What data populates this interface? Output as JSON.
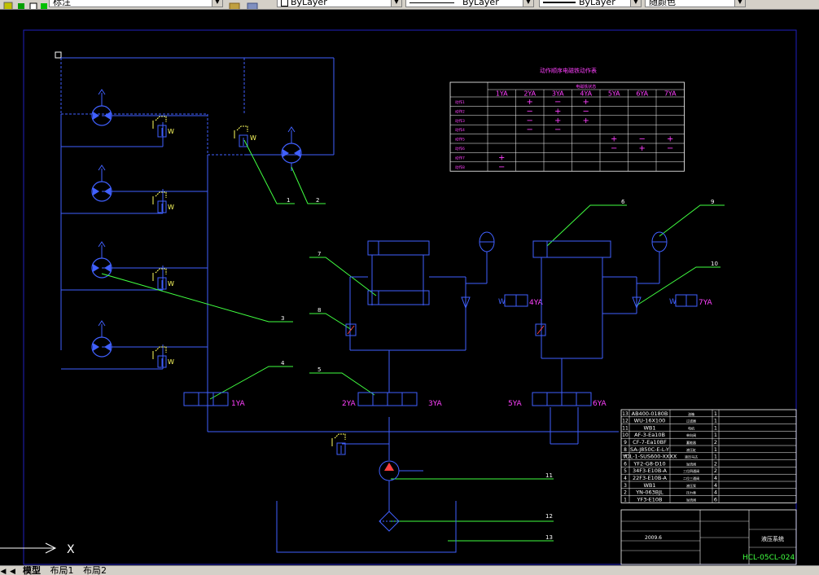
{
  "toolbar": {
    "textstyle": {
      "value": "标注"
    },
    "layer_color": {
      "value": "ByLayer"
    },
    "linetype": {
      "value": "ByLayer"
    },
    "lineweight": {
      "value": "ByLayer"
    },
    "plotstyle": {
      "value": "随颜色"
    }
  },
  "tabs": {
    "model": "模型",
    "layout1": "布局1",
    "layout2": "布局2"
  },
  "drawing": {
    "table_title": "动作顺序电磁铁动作表",
    "table_header": "电磁铁状态",
    "yas": [
      "1YA",
      "2YA",
      "3YA",
      "4YA",
      "5YA",
      "6YA",
      "7YA"
    ],
    "table_rows": [
      {
        "name": "动作1",
        "cells": [
          "",
          "+",
          "−",
          "+",
          "",
          "",
          ""
        ]
      },
      {
        "name": "动作2",
        "cells": [
          "",
          "−",
          "+",
          "−",
          "",
          "",
          ""
        ]
      },
      {
        "name": "动作3",
        "cells": [
          "",
          "−",
          "+",
          "+",
          "",
          "",
          ""
        ]
      },
      {
        "name": "动作4",
        "cells": [
          "",
          "−",
          "−",
          "",
          "",
          "",
          ""
        ]
      },
      {
        "name": "动作5",
        "cells": [
          "",
          "",
          "",
          "",
          "+",
          "−",
          "+"
        ]
      },
      {
        "name": "动作6",
        "cells": [
          "",
          "",
          "",
          "",
          "−",
          "+",
          "−"
        ]
      },
      {
        "name": "动作7",
        "cells": [
          "+",
          "",
          "",
          "",
          "",
          "",
          ""
        ]
      },
      {
        "name": "动作8",
        "cells": [
          "−",
          "",
          "",
          "",
          "",
          "",
          ""
        ]
      }
    ],
    "valve_labels": {
      "v1": "1YA",
      "v2": "2YA",
      "v3": "3YA",
      "v4": "4YA",
      "v5": "5YA",
      "v6": "6YA",
      "v7": "7YA"
    },
    "spring_mark": "W",
    "callouts": [
      "1",
      "2",
      "3",
      "4",
      "5",
      "6",
      "7",
      "8",
      "9",
      "10",
      "11",
      "12",
      "13"
    ],
    "parts": [
      {
        "no": "13",
        "code": "AB400-0180B",
        "name": "油箱",
        "qty": "1"
      },
      {
        "no": "12",
        "code": "WU-16X100",
        "name": "过滤器",
        "qty": "1"
      },
      {
        "no": "11",
        "code": "WB1",
        "name": "电机",
        "qty": "1"
      },
      {
        "no": "10",
        "code": "AF-3-Ea10B",
        "name": "单向阀",
        "qty": "1"
      },
      {
        "no": "9",
        "code": "CF-7-Ea10BF",
        "name": "蓄能器",
        "qty": "2"
      },
      {
        "no": "8",
        "code": "SA-J850C-E-L-Y",
        "name": "液压缸",
        "qty": "1"
      },
      {
        "no": "7",
        "code": "YDL-1-SUS600-XXXX",
        "name": "液压马达",
        "qty": "1"
      },
      {
        "no": "6",
        "code": "YF2-G8-D10",
        "name": "溢流阀",
        "qty": "2"
      },
      {
        "no": "5",
        "code": "34F3-E10B-A",
        "name": "三位四通阀",
        "qty": "2"
      },
      {
        "no": "4",
        "code": "22F3-E10B-A",
        "name": "二位三通阀",
        "qty": "4"
      },
      {
        "no": "3",
        "code": "WB1",
        "name": "液压泵",
        "qty": "4"
      },
      {
        "no": "2",
        "code": "YN-063BJL",
        "name": "压力表",
        "qty": "4"
      },
      {
        "no": "1",
        "code": "YF3-E10B",
        "name": "溢流阀",
        "qty": "6"
      }
    ],
    "title_block": {
      "name": "液压系统",
      "drawing_no": "HCL-05CL-024",
      "date": "2009.6"
    }
  }
}
